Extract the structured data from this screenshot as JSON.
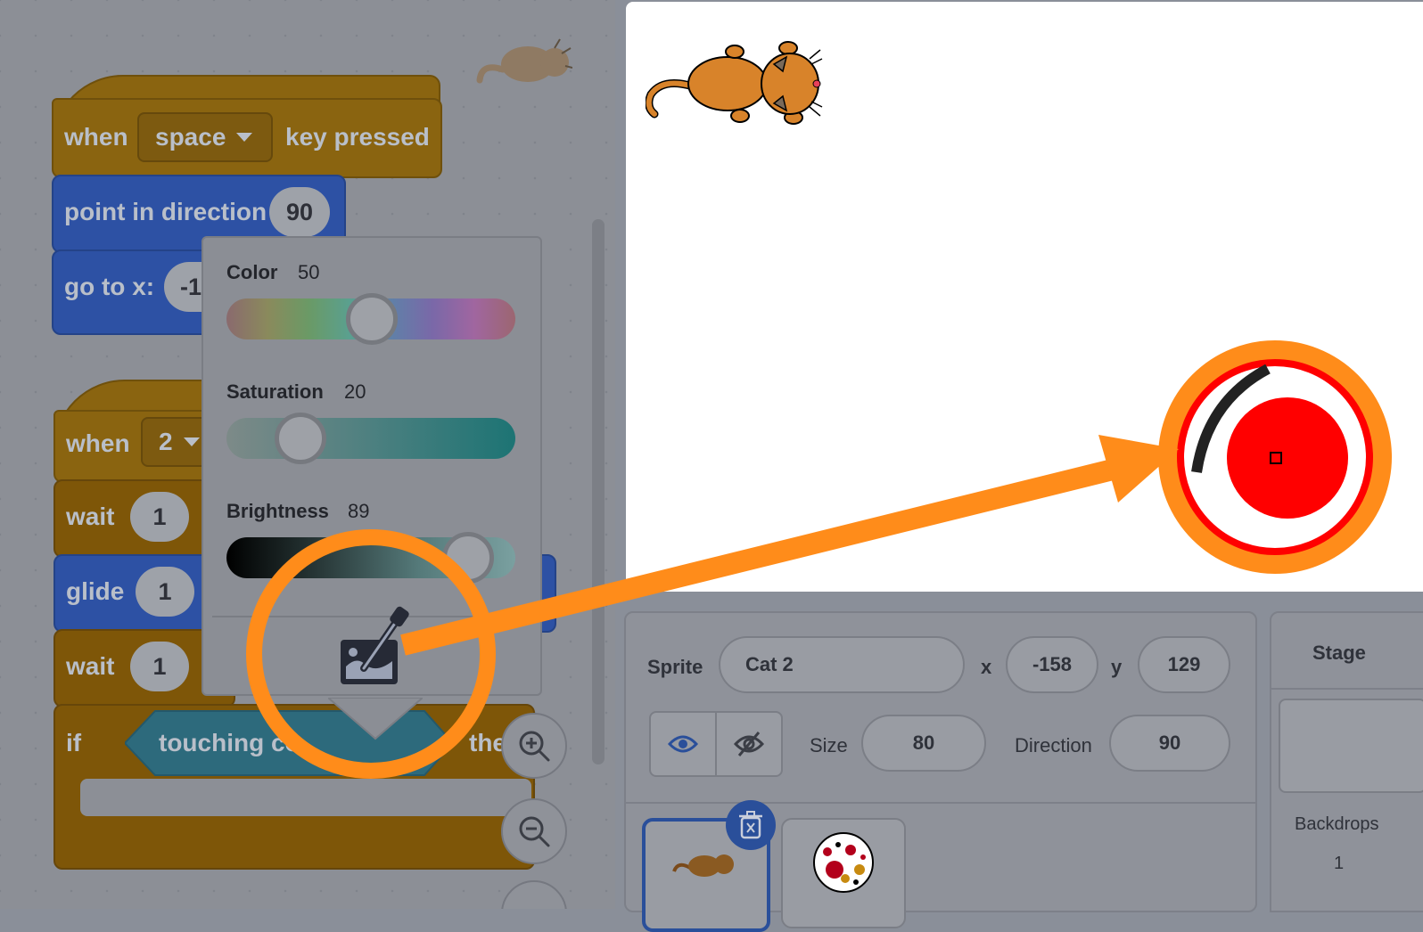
{
  "code": {
    "script1": {
      "when": "when",
      "key": "space",
      "key_pressed": "key pressed",
      "point_in_direction": "point in direction",
      "direction": "90",
      "go_to_x": "go to x:",
      "x_partial": "-1"
    },
    "script2": {
      "when": "when",
      "key": "2",
      "wait1": "wait",
      "wait1_val": "1",
      "glide": "glide",
      "glide_val": "1",
      "wait2": "wait",
      "wait2_val": "1",
      "if": "if",
      "touching": "touching co",
      "then": "the"
    }
  },
  "color_picker": {
    "color_label": "Color",
    "color_value": "50",
    "saturation_label": "Saturation",
    "saturation_value": "20",
    "brightness_label": "Brightness",
    "brightness_value": "89",
    "eyedropper_icon": "eyedropper-icon",
    "highlight_color": "#ff8c1a",
    "sampled_color": "#ff0000"
  },
  "sprite_info": {
    "sprite_label": "Sprite",
    "sprite_name": "Cat 2",
    "x_label": "x",
    "x_value": "-158",
    "y_label": "y",
    "y_value": "129",
    "size_label": "Size",
    "size_value": "80",
    "direction_label": "Direction",
    "direction_value": "90"
  },
  "stage_panel": {
    "title": "Stage",
    "backdrops_label": "Backdrops",
    "backdrops_count": "1"
  }
}
